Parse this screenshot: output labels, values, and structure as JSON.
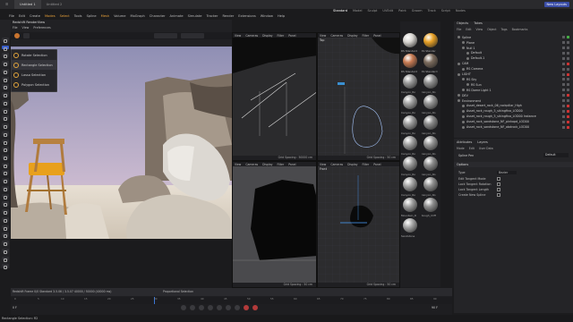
{
  "window": {
    "tabs": [
      "Untitled 1",
      "Untitled 2"
    ],
    "layout_tabs": [
      "Standard",
      "Model",
      "Sculpt",
      "UVEdit",
      "Paint",
      "Groom",
      "Track",
      "Script",
      "Nodes"
    ],
    "new_layouts": "New Layouts"
  },
  "menu": [
    "File",
    "Edit",
    "Create",
    "Modes",
    "Select",
    "Tools",
    "Spline",
    "Mesh",
    "Volume",
    "MoGraph",
    "Character",
    "Animate",
    "Simulate",
    "Tracker",
    "Render",
    "Extensions",
    "Window",
    "Help"
  ],
  "viewport_title": "Redshift RenderView",
  "viewport_menu": [
    "File",
    "View",
    "Preferences"
  ],
  "selection_popup": [
    "Rotate Selection",
    "Rectangle Selection",
    "Lasso Selection",
    "Polygon Selection"
  ],
  "viewports": [
    {
      "name": "perspective",
      "menu": [
        "View",
        "Cameras",
        "Display",
        "Filter",
        "Panel"
      ],
      "label": "Perspective",
      "camera": "RS Camera",
      "grid": "Grid Spacing : 50000 cm"
    },
    {
      "name": "top",
      "menu": [
        "View",
        "Cameras",
        "Display",
        "Filter",
        "Panel"
      ],
      "label": "Top",
      "grid": "Grid Spacing : 50 cm"
    },
    {
      "name": "right",
      "menu": [
        "View",
        "Cameras",
        "Display",
        "Filter",
        "Panel"
      ],
      "label": "Right",
      "grid": "Grid Spacing : 50 cm"
    },
    {
      "name": "front",
      "menu": [
        "View",
        "Cameras",
        "Display",
        "Filter",
        "Panel"
      ],
      "label": "Front",
      "grid": "Grid Spacing : 50 cm"
    }
  ],
  "spline_pen": "Spline Pen",
  "materials": [
    {
      "label": "RS Standard",
      "color": "#d9d6d2"
    },
    {
      "label": "RS Standar",
      "color": "#e8a126"
    },
    {
      "label": "RS Standard",
      "color": "#c77a52"
    },
    {
      "label": "RS Standard",
      "color": "#7a6a5c"
    },
    {
      "label": "Canyon_Ro",
      "color": "#9a9a9a"
    },
    {
      "label": "Canyon_Ro",
      "color": "#8f8f8f"
    },
    {
      "label": "Canyon_Ro",
      "color": "#a3a3a3"
    },
    {
      "label": "Canyon_Ro",
      "color": "#949494"
    },
    {
      "label": "Canyon_Ro",
      "color": "#9c9c9c"
    },
    {
      "label": "Canyon_Ro",
      "color": "#8a8a8a"
    },
    {
      "label": "Canyon_Ro",
      "color": "#a0a0a0"
    },
    {
      "label": "Canyon_Ro",
      "color": "#969696"
    },
    {
      "label": "Canyon_Ro",
      "color": "#999999"
    },
    {
      "label": "Canyon_Ro",
      "color": "#8c8c8c"
    },
    {
      "label": "Canyon_Ro",
      "color": "#a5a5a5"
    },
    {
      "label": "Canyon_Ro",
      "color": "#909090"
    },
    {
      "label": "Mountain_R",
      "color": "#9e9e9e"
    },
    {
      "label": "Rough_Cliff",
      "color": "#8e8e8e"
    },
    {
      "label": "Sandstone",
      "color": "#a8a8a8"
    }
  ],
  "object_manager": {
    "tabs": [
      "Objects",
      "Takes"
    ],
    "menu": [
      "File",
      "Edit",
      "View",
      "Object",
      "Tags",
      "Bookmarks"
    ],
    "items": [
      {
        "name": "Spline",
        "indent": 0,
        "flag": "grn"
      },
      {
        "name": "Plane",
        "indent": 1,
        "flag": ""
      },
      {
        "name": "Null 1",
        "indent": 1,
        "flag": ""
      },
      {
        "name": "Default",
        "indent": 2,
        "flag": ""
      },
      {
        "name": "Default.1",
        "indent": 2,
        "flag": ""
      },
      {
        "name": "CAM",
        "indent": 0,
        "flag": "red"
      },
      {
        "name": "RS Camera",
        "indent": 1,
        "flag": ""
      },
      {
        "name": "LIGHT",
        "indent": 0,
        "flag": "red"
      },
      {
        "name": "RS Sky",
        "indent": 1,
        "flag": ""
      },
      {
        "name": "RS Sun",
        "indent": 2,
        "flag": ""
      },
      {
        "name": "RS Dome Light 1",
        "indent": 1,
        "flag": ""
      },
      {
        "name": "DEV",
        "indent": 0,
        "flag": "red"
      },
      {
        "name": "Environment",
        "indent": 0,
        "flag": ""
      },
      {
        "name": "Asset_desert_rock_06_rockpillar_High",
        "indent": 1,
        "flag": "red"
      },
      {
        "name": "Asset_rock_rough_5_sikingfiva_LOD00",
        "indent": 1,
        "flag": "red"
      },
      {
        "name": "Asset_rock_rough_5_sikingfiva_LOD00 Instance",
        "indent": 1,
        "flag": "red"
      },
      {
        "name": "Asset_rock_sandstone_NF_pinkopd_LOD00",
        "indent": 1,
        "flag": "red"
      },
      {
        "name": "Asset_rock_sandstone_NF_abdrock_LOD00",
        "indent": 1,
        "flag": "red"
      }
    ]
  },
  "attributes": {
    "tabs": [
      "Attributes",
      "Layers"
    ],
    "menu": [
      "Mode",
      "Edit",
      "User Data"
    ],
    "object": "Spline Pen",
    "mode_value": "Default",
    "section": "Options",
    "type_label": "Type",
    "type_value": "Bezier",
    "options": [
      "Edit Tangent Mode",
      "Lock Tangent Rotation",
      "Lock Tangent Length",
      "Create New Spline"
    ]
  },
  "timeline": {
    "ticks": [
      "0",
      "5",
      "10",
      "15",
      "20",
      "25",
      "30",
      "35",
      "40",
      "45",
      "50",
      "55",
      "60",
      "65",
      "70",
      "75",
      "80",
      "85",
      "90"
    ],
    "current_frame": "0 F",
    "end_frame": "90 F",
    "proportional": "Proportional Selection"
  },
  "render_status": "Redshift  Frame 0/0  Standard  3.5.06 / 3.5.07  40000 / 50000 (40000 ms)",
  "status_bar": "Rectangle Selection: R2",
  "colors": {
    "accent": "#3b4ea8",
    "orange": "#e8a13a"
  }
}
